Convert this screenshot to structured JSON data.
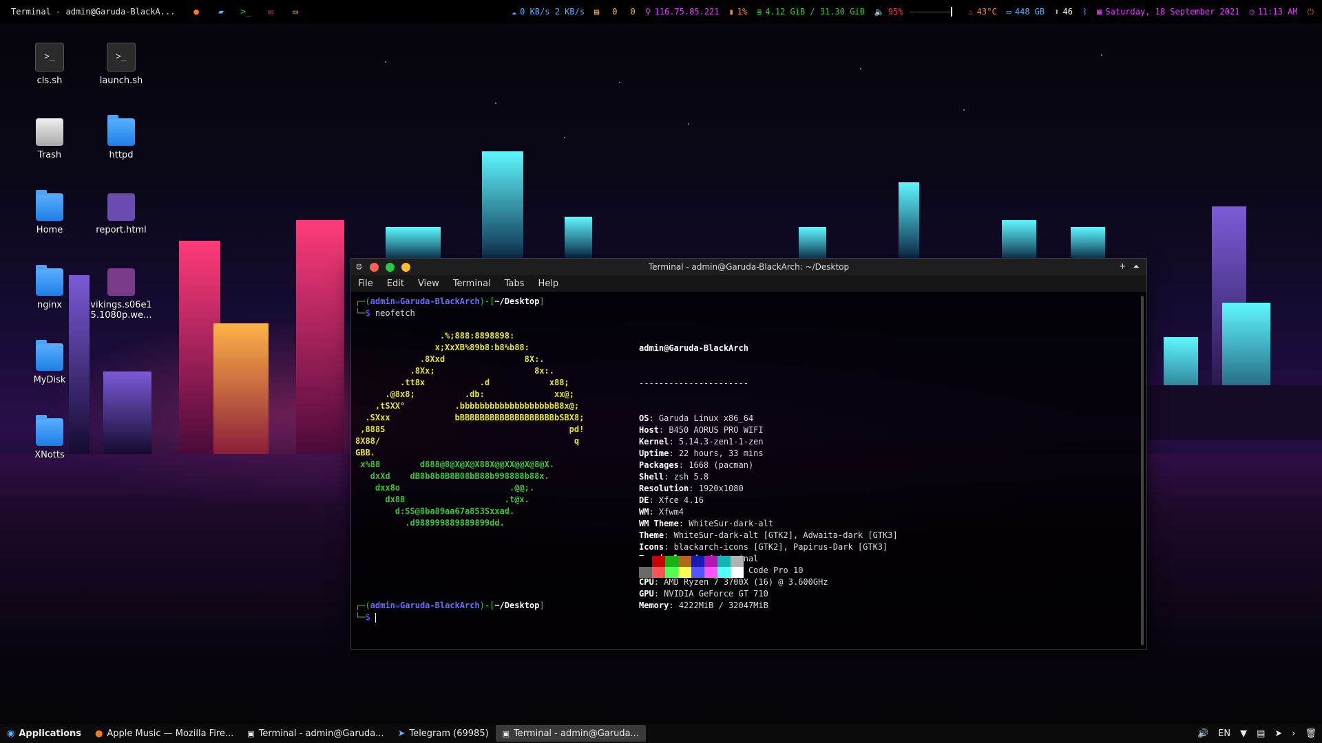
{
  "top_panel": {
    "window_title": "Terminal - admin@Garuda-BlackA...",
    "stats": {
      "network": "0 KB/s 2 KB/s",
      "disk_read": "0",
      "disk_write": "0",
      "ip": "116.75.85.221",
      "cpu": "1%",
      "memory": "4.12 GiB / 31.30 GiB",
      "volume": "95%",
      "temperature": "43°C",
      "storage": "448 GB",
      "updates": "46",
      "date": "Saturday, 18 September 2021",
      "time": "11:13 AM"
    },
    "colors": {
      "accent_blue": "#5ab0ff",
      "green": "#37c837",
      "magenta": "#e040fb",
      "orange": "#ff8a1f",
      "red": "#ff3b3b"
    }
  },
  "desktop_icons": [
    {
      "label": "cls.sh",
      "type": "script",
      "icon": "terminal-script-icon"
    },
    {
      "label": "launch.sh",
      "type": "script",
      "icon": "terminal-script-icon"
    },
    {
      "label": "Trash",
      "type": "trash",
      "icon": "trash-icon"
    },
    {
      "label": "httpd",
      "type": "folder",
      "icon": "folder-icon"
    },
    {
      "label": "Home",
      "type": "folder",
      "icon": "home-folder-icon"
    },
    {
      "label": "report.html",
      "type": "web",
      "icon": "html-file-icon"
    },
    {
      "label": "nginx",
      "type": "folder",
      "icon": "folder-icon"
    },
    {
      "label": "vikings.s06e1 5.1080p.we...",
      "type": "video",
      "icon": "video-file-icon"
    },
    {
      "label": "MyDisk",
      "type": "folder",
      "icon": "folder-icon"
    },
    {
      "label": "XNotts",
      "type": "folder",
      "icon": "locked-folder-icon"
    }
  ],
  "terminal": {
    "title": "Terminal - admin@Garuda-BlackArch: ~/Desktop",
    "menu": [
      "File",
      "Edit",
      "View",
      "Terminal",
      "Tabs",
      "Help"
    ],
    "prompt": {
      "user": "admin",
      "host": "Garuda-BlackArch",
      "dir": "~/Desktop",
      "symbol": "$"
    },
    "command": "neofetch",
    "ascii_art": [
      "                 .%;888:8898898:",
      "                x;XxXB%89b8:b8%b88:",
      "             .8Xxd                8X:.",
      "           .8Xx;                    8x:.",
      "         .tt8x           .d            x88;",
      "      .@8x8;          .db:              xx@;",
      "    ,tSXX°          .bbbbbbbbbbbbbbbbbbbB8x@;",
      "  .SXxx             bBBBBBBBBBBBBBBBBBBBbSBX8;",
      " ,888S                                     pd!",
      "8X88/                                       q",
      "GBB.",
      " x%88        d888@8@X@X@X88X@@XX@@X@8@X.",
      "   dxXd    dB8b8b8B8B08bB88b998888b88x.",
      "    dxx8o                      .@@;.",
      "      dx88                    .t@x.",
      "        d:SS@8ba89aa67a853Sxxad.",
      "          .d988999889889899dd."
    ],
    "neofetch_header": "admin@Garuda-BlackArch",
    "neofetch_separator": "----------------------",
    "neofetch_info": [
      {
        "key": "OS",
        "value": "Garuda Linux x86_64"
      },
      {
        "key": "Host",
        "value": "B450 AORUS PRO WIFI"
      },
      {
        "key": "Kernel",
        "value": "5.14.3-zen1-1-zen"
      },
      {
        "key": "Uptime",
        "value": "22 hours, 33 mins"
      },
      {
        "key": "Packages",
        "value": "1668 (pacman)"
      },
      {
        "key": "Shell",
        "value": "zsh 5.8"
      },
      {
        "key": "Resolution",
        "value": "1920x1080"
      },
      {
        "key": "DE",
        "value": "Xfce 4.16"
      },
      {
        "key": "WM",
        "value": "Xfwm4"
      },
      {
        "key": "WM Theme",
        "value": "WhiteSur-dark-alt"
      },
      {
        "key": "Theme",
        "value": "WhiteSur-dark-alt [GTK2], Adwaita-dark [GTK3]"
      },
      {
        "key": "Icons",
        "value": "blackarch-icons [GTK2], Papirus-Dark [GTK3]"
      },
      {
        "key": "Terminal",
        "value": "xfce4-terminal"
      },
      {
        "key": "Terminal Font",
        "value": "Source Code Pro 10"
      },
      {
        "key": "CPU",
        "value": "AMD Ryzen 7 3700X (16) @ 3.600GHz"
      },
      {
        "key": "GPU",
        "value": "NVIDIA GeForce GT 710"
      },
      {
        "key": "Memory",
        "value": "4222MiB / 32047MiB"
      }
    ],
    "palette": [
      "#000000",
      "#cc0000",
      "#18b218",
      "#b26818",
      "#1818b2",
      "#b218b2",
      "#18b2b2",
      "#b2b2b2",
      "#686868",
      "#ff5454",
      "#54ff54",
      "#ffff54",
      "#5454ff",
      "#ff54ff",
      "#54ffff",
      "#ffffff"
    ]
  },
  "taskbar": {
    "applications": "Applications",
    "tasks": [
      {
        "label": "Apple Music — Mozilla Fire...",
        "icon": "firefox-icon",
        "active": false
      },
      {
        "label": "Terminal - admin@Garuda...",
        "icon": "terminal-icon",
        "active": false
      },
      {
        "label": "Telegram (69985)",
        "icon": "telegram-icon",
        "active": false
      },
      {
        "label": "Terminal - admin@Garuda...",
        "icon": "terminal-icon",
        "active": true
      }
    ],
    "tray_language": "EN"
  }
}
